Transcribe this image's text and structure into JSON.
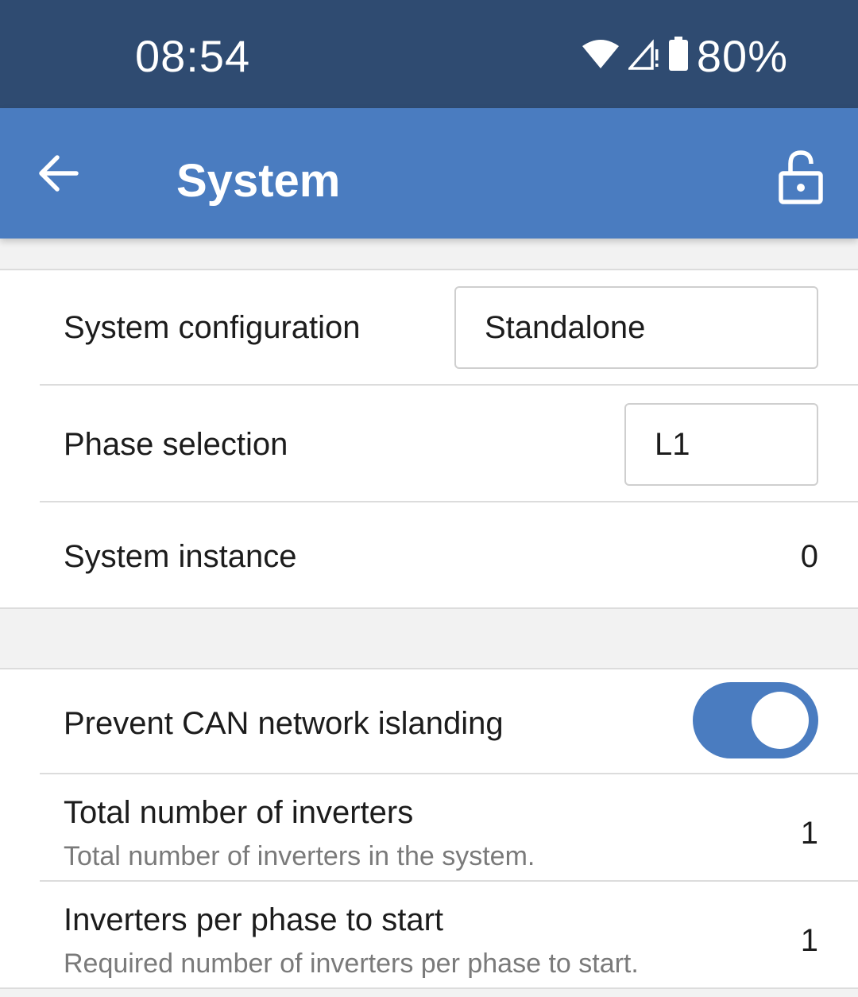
{
  "status_bar": {
    "time": "08:54",
    "battery_percent": "80%",
    "icons": [
      "wifi-icon",
      "cell-signal-icon",
      "battery-icon"
    ]
  },
  "app_bar": {
    "title": "System",
    "back_icon": "arrow-back-icon",
    "lock_icon": "lock-open-icon"
  },
  "settings": {
    "system_configuration": {
      "label": "System configuration",
      "value": "Standalone"
    },
    "phase_selection": {
      "label": "Phase selection",
      "value": "L1"
    },
    "system_instance": {
      "label": "System instance",
      "value": "0"
    },
    "prevent_can_islanding": {
      "label": "Prevent CAN network islanding",
      "enabled": true
    },
    "total_inverters": {
      "label": "Total number of inverters",
      "description": "Total number of inverters in the system.",
      "value": "1"
    },
    "inverters_per_phase": {
      "label": "Inverters per phase to start",
      "description": "Required number of inverters per phase to start.",
      "value": "1"
    }
  },
  "colors": {
    "status_bar": "#2f4b71",
    "app_bar": "#4a7cc0",
    "toggle_on": "#4a7cc0",
    "background": "#f2f2f2"
  }
}
